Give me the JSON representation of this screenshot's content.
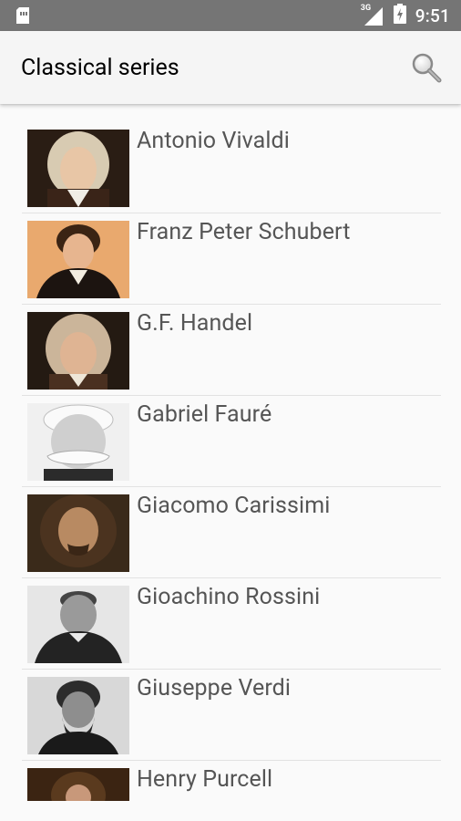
{
  "status_bar": {
    "time": "9:51",
    "network": "3G",
    "icons": [
      "sim-card-icon",
      "signal-icon",
      "battery-icon"
    ]
  },
  "app_bar": {
    "title": "Classical series",
    "search_icon": "search-icon"
  },
  "composers": [
    {
      "name": "Antonio Vivaldi"
    },
    {
      "name": "Franz Peter Schubert"
    },
    {
      "name": "G.F. Handel"
    },
    {
      "name": "Gabriel Fauré"
    },
    {
      "name": "Giacomo Carissimi"
    },
    {
      "name": "Gioachino Rossini"
    },
    {
      "name": "Giuseppe Verdi"
    },
    {
      "name": "Henry Purcell"
    }
  ]
}
